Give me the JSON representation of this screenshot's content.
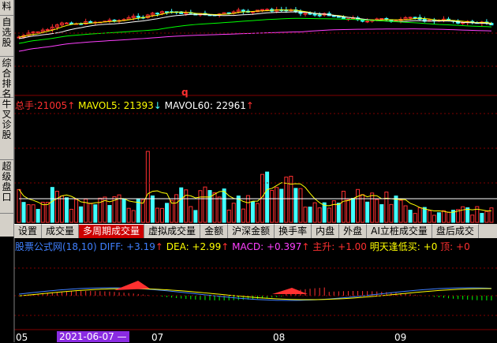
{
  "side_tabs": [
    "料",
    "自选股",
    "综合排名",
    "牛叉诊股",
    "超级盘口"
  ],
  "price_panel": {
    "marker": "q"
  },
  "volume_header": {
    "total_label": "总手:",
    "total_value": "21005",
    "total_arrow": "↑",
    "mavol5_label": "MAVOL5:",
    "mavol5_value": "21393",
    "mavol5_arrow": "↓",
    "mavol60_label": "MAVOL60:",
    "mavol60_value": "22961",
    "mavol60_arrow": "↑"
  },
  "tabs": [
    "设置",
    "成交量",
    "多周期成交量",
    "虚拟成交量",
    "金额",
    "沪深金额",
    "换手率",
    "内盘",
    "外盘",
    "AI立桩成交量",
    "盘后成交"
  ],
  "active_tab": 2,
  "indicator_header": {
    "name": "股票公式网(18,10)",
    "diff_label": "DIFF:",
    "diff_value": "+3.19",
    "diff_arrow": "↑",
    "dea_label": "DEA:",
    "dea_value": "+2.99",
    "dea_arrow": "↑",
    "macd_label": "MACD:",
    "macd_value": "+0.397",
    "macd_arrow": "↑",
    "zs_label": "主升:",
    "zs_value": "+1.00",
    "mt_label": "明天逢低买:",
    "mt_value": "+0",
    "ding_label": "顶:",
    "ding_value": "+0"
  },
  "x_axis": {
    "labels": [
      "05",
      "07",
      "08",
      "09"
    ],
    "cursor_date": "2021-06-07 —"
  },
  "colors": {
    "up": "#ff3030",
    "down": "#40ffff",
    "ma_yellow": "#ffff00",
    "ma_white": "#ffffff",
    "ma_green": "#00ff00",
    "ma_magenta": "#ff40ff",
    "grid": "#800000"
  }
}
